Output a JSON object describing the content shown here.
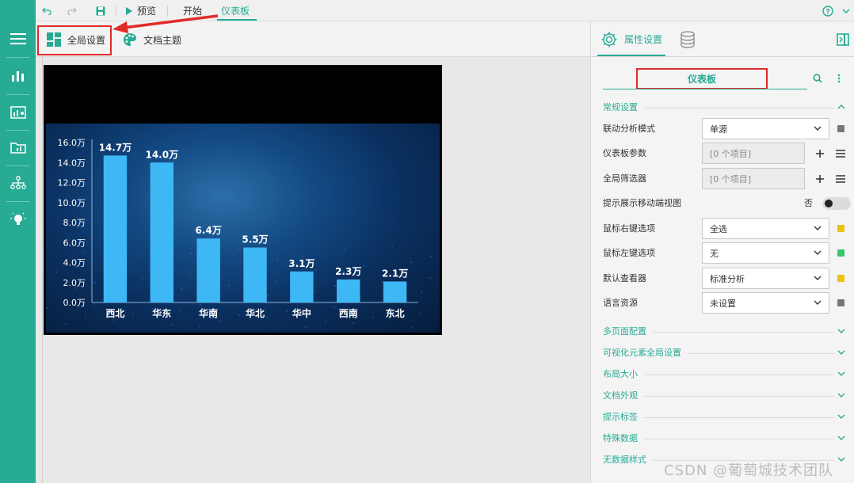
{
  "toolbar": {
    "preview_label": "预览",
    "start_tab": "开始",
    "dashboard_tab": "仪表板"
  },
  "ribbon": {
    "global_settings_label": "全局设置",
    "doc_theme_label": "文档主题"
  },
  "chart_data": {
    "type": "bar",
    "categories": [
      "西北",
      "华东",
      "华南",
      "华北",
      "华中",
      "西南",
      "东北"
    ],
    "values": [
      14.7,
      14.0,
      6.4,
      5.5,
      3.1,
      2.3,
      2.1
    ],
    "data_labels": [
      "14.7万",
      "14.0万",
      "6.4万",
      "5.5万",
      "3.1万",
      "2.3万",
      "2.1万"
    ],
    "y_ticks": [
      "0.0万",
      "2.0万",
      "4.0万",
      "6.0万",
      "8.0万",
      "10.0万",
      "12.0万",
      "14.0万",
      "16.0万"
    ],
    "ylim": [
      0,
      16
    ],
    "bar_color": "#3db8f5",
    "grid": false
  },
  "panel": {
    "tab_properties": "属性设置",
    "title": "仪表板",
    "section_general": "常规设置",
    "rows": {
      "linkage_mode": {
        "label": "联动分析模式",
        "value": "单源"
      },
      "dashboard_params": {
        "label": "仪表板参数",
        "value": "[0 个项目]"
      },
      "global_filter": {
        "label": "全局筛选器",
        "value": "[0 个项目]"
      },
      "mobile_view_hint": {
        "label": "提示展示移动端视图",
        "value": "否"
      },
      "right_click": {
        "label": "鼠标右键选项",
        "value": "全选"
      },
      "left_click": {
        "label": "鼠标左键选项",
        "value": "无"
      },
      "default_viewer": {
        "label": "默认查看器",
        "value": "标准分析"
      },
      "language": {
        "label": "语言资源",
        "value": "未设置"
      }
    },
    "sections": [
      "多页面配置",
      "可视化元素全局设置",
      "布局大小",
      "文档外观",
      "提示标签",
      "特殊数据",
      "无数据样式"
    ]
  },
  "colors": {
    "accent": "#27ab94",
    "highlight": "#e02b2b",
    "status_gray": "#777777",
    "status_yellow": "#e8c20e",
    "status_green": "#3cc46b"
  },
  "watermark": "CSDN @葡萄城技术团队"
}
